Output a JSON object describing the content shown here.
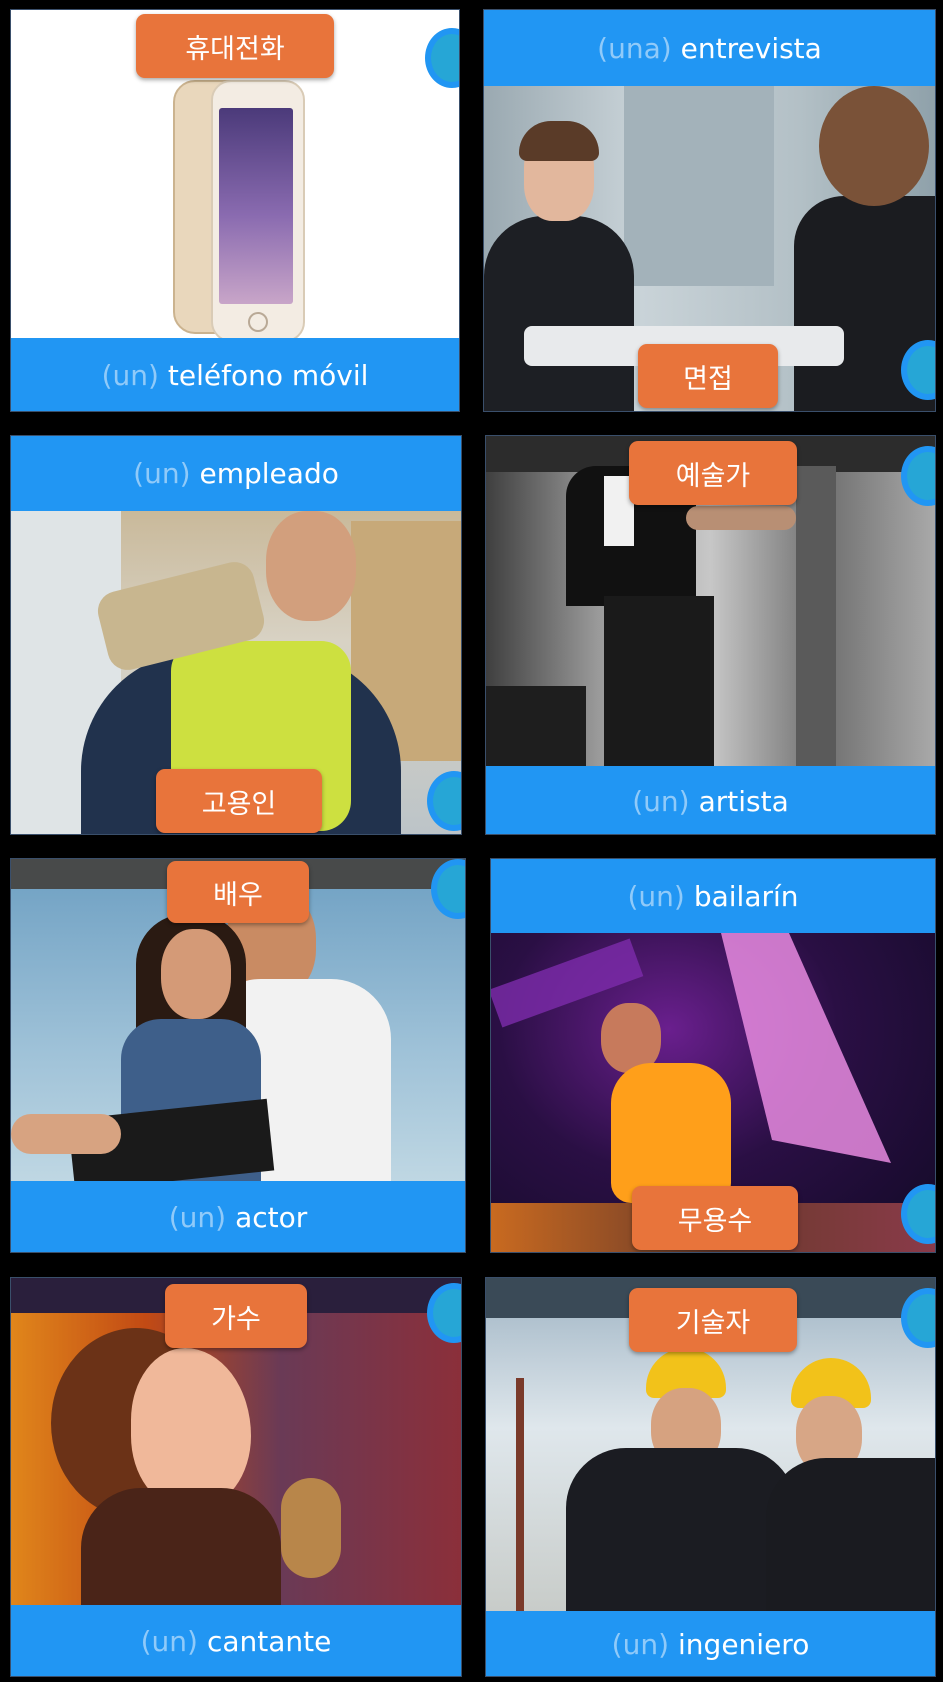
{
  "cards": [
    {
      "word": "teléfono móvil",
      "article": "(un)",
      "native": "휴대전화",
      "image": "mobile-phone"
    },
    {
      "word": "entrevista",
      "article": "(una)",
      "native": "면접",
      "image": "job-interview"
    },
    {
      "word": "empleado",
      "article": "(un)",
      "native": "고용인",
      "image": "employee"
    },
    {
      "word": "artista",
      "article": "(un)",
      "native": "예술가",
      "image": "graffiti-artist"
    },
    {
      "word": "actor",
      "article": "(un)",
      "native": "배우",
      "image": "actors-couple"
    },
    {
      "word": "bailarín",
      "article": "(un)",
      "native": "무용수",
      "image": "flamenco-dancer"
    },
    {
      "word": "cantante",
      "article": "(un)",
      "native": "가수",
      "image": "singer"
    },
    {
      "word": "ingeniero",
      "article": "(un)",
      "native": "기술자",
      "image": "engineers"
    }
  ],
  "colors": {
    "bar": "#2196f3",
    "native_label": "#e8743b",
    "article": "#90caf9",
    "background": "#000000"
  }
}
